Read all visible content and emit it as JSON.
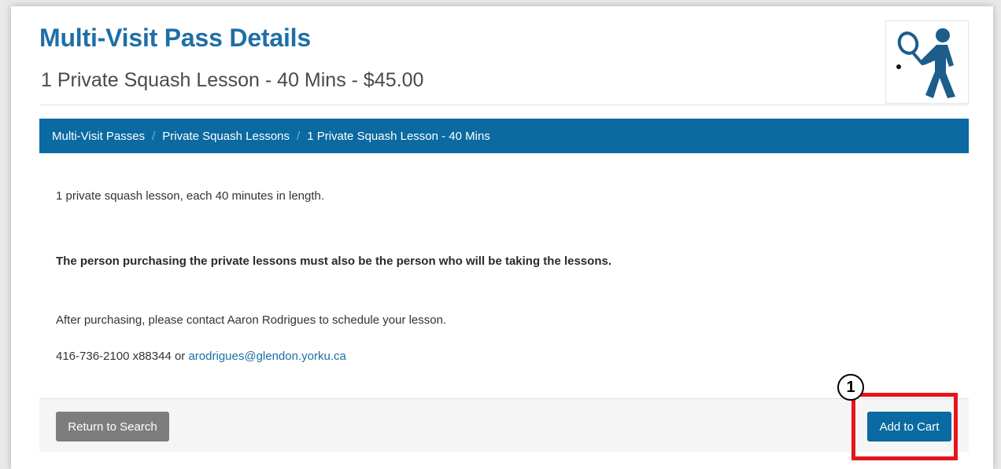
{
  "header": {
    "title": "Multi-Visit Pass Details",
    "subtitle": "1 Private Squash Lesson - 40 Mins - $45.00",
    "logo_icon": "squash-player-icon"
  },
  "breadcrumb": {
    "items": [
      "Multi-Visit Passes",
      "Private Squash Lessons",
      "1 Private Squash Lesson - 40 Mins"
    ],
    "separator": "/"
  },
  "content": {
    "description": "1 private squash lesson, each 40 minutes in length.",
    "notice": "The person purchasing the private lessons must also be the person who will be taking the lessons.",
    "instructions": "After purchasing, please contact Aaron Rodrigues to schedule your lesson.",
    "phone_prefix": "416-736-2100 x88344 or ",
    "email": "arodrigues@glendon.yorku.ca"
  },
  "footer": {
    "return_label": "Return to Search",
    "cart_label": "Add to Cart"
  },
  "annotation": {
    "callout_number": "1"
  },
  "colors": {
    "brand_blue": "#0a6aa1",
    "title_blue": "#1f6fa6",
    "highlight_red": "#e8141b",
    "return_gray": "#7d7d7d"
  }
}
